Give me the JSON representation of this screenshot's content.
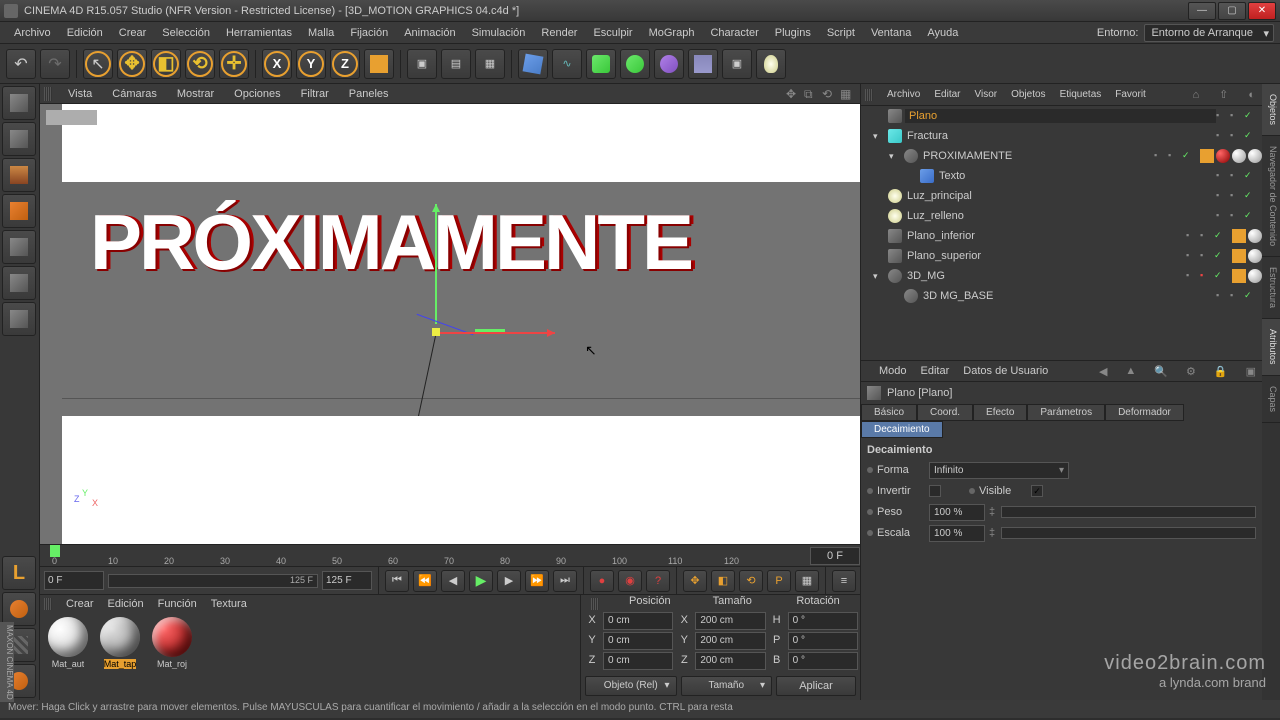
{
  "window": {
    "title": "CINEMA 4D R15.057 Studio (NFR Version - Restricted License) - [3D_MOTION GRAPHICS 04.c4d *]"
  },
  "menubar": {
    "items": [
      "Archivo",
      "Edición",
      "Crear",
      "Selección",
      "Herramientas",
      "Malla",
      "Fijación",
      "Animación",
      "Simulación",
      "Render",
      "Esculpir",
      "MoGraph",
      "Character",
      "Plugins",
      "Script",
      "Ventana",
      "Ayuda"
    ],
    "env_label": "Entorno:",
    "env_value": "Entorno de Arranque"
  },
  "viewmenu": {
    "items": [
      "Vista",
      "Cámaras",
      "Mostrar",
      "Opciones",
      "Filtrar",
      "Paneles"
    ]
  },
  "viewport": {
    "text3d": "PRÓXIMAMENTE",
    "axes": {
      "x": "X",
      "y": "Y",
      "z": "Z"
    }
  },
  "timeline": {
    "ticks": [
      "0",
      "10",
      "20",
      "30",
      "40",
      "50",
      "60",
      "70",
      "80",
      "90",
      "100",
      "110",
      "120"
    ],
    "range_end": "0 F"
  },
  "transport": {
    "cur_frame": "0 F",
    "range": "125 F",
    "total": "125 F"
  },
  "materials": {
    "menu": [
      "Crear",
      "Edición",
      "Función",
      "Textura"
    ],
    "items": [
      {
        "label": "Mat_aut",
        "color": "white"
      },
      {
        "label": "Mat_tap",
        "color": "grey",
        "selected": true
      },
      {
        "label": "Mat_roj",
        "color": "red"
      }
    ]
  },
  "coord": {
    "headers": [
      "Posición",
      "Tamaño",
      "Rotación"
    ],
    "rows": [
      {
        "axis": "X",
        "pos": "0 cm",
        "sizeAxis": "X",
        "size": "200 cm",
        "rotAxis": "H",
        "rot": "0 °"
      },
      {
        "axis": "Y",
        "pos": "0 cm",
        "sizeAxis": "Y",
        "size": "200 cm",
        "rotAxis": "P",
        "rot": "0 °"
      },
      {
        "axis": "Z",
        "pos": "0 cm",
        "sizeAxis": "Z",
        "size": "200 cm",
        "rotAxis": "B",
        "rot": "0 °"
      }
    ],
    "mode1": "Objeto (Rel)",
    "mode2": "Tamaño",
    "apply": "Aplicar"
  },
  "objmenu": {
    "items": [
      "Archivo",
      "Editar",
      "Visor",
      "Objetos",
      "Etiquetas",
      "Favorit"
    ]
  },
  "tree": [
    {
      "name": "Plano",
      "icon": "plane",
      "depth": 0,
      "exp": "",
      "sel": true,
      "tags": []
    },
    {
      "name": "Fractura",
      "icon": "fract",
      "depth": 0,
      "exp": "▾",
      "tags": []
    },
    {
      "name": "PROXIMAMENTE",
      "icon": "null",
      "depth": 1,
      "exp": "▾",
      "tags": [
        "tag",
        "red",
        "white",
        "white"
      ]
    },
    {
      "name": "Texto",
      "icon": "text",
      "depth": 2,
      "exp": "",
      "tags": []
    },
    {
      "name": "Luz_principal",
      "icon": "light",
      "depth": 0,
      "exp": "",
      "tags": []
    },
    {
      "name": "Luz_relleno",
      "icon": "light",
      "depth": 0,
      "exp": "",
      "tags": []
    },
    {
      "name": "Plano_inferior",
      "icon": "plane",
      "depth": 0,
      "exp": "",
      "tags": [
        "tag",
        "white"
      ]
    },
    {
      "name": "Plano_superior",
      "icon": "plane",
      "depth": 0,
      "exp": "",
      "tags": [
        "tag",
        "white"
      ]
    },
    {
      "name": "3D_MG",
      "icon": "null",
      "depth": 0,
      "exp": "▾",
      "vis": "red",
      "tags": [
        "tag",
        "white"
      ]
    },
    {
      "name": "3D MG_BASE",
      "icon": "null",
      "depth": 1,
      "exp": "",
      "tags": []
    }
  ],
  "attrmenu": {
    "items": [
      "Modo",
      "Editar",
      "Datos de Usuario"
    ]
  },
  "attr": {
    "title": "Plano [Plano]",
    "tabs": [
      "Básico",
      "Coord.",
      "Efecto",
      "Parámetros",
      "Deformador"
    ],
    "tab_selected": "Decaimiento",
    "section": "Decaimiento",
    "forma_label": "Forma",
    "forma_value": "Infinito",
    "invertir_label": "Invertir",
    "visible_label": "Visible",
    "peso_label": "Peso",
    "peso_value": "100 %",
    "escala_label": "Escala",
    "escala_value": "100 %"
  },
  "rtabs": [
    "Objetos",
    "Navegador de Contenido",
    "Estructura",
    "Atributos",
    "Capas"
  ],
  "status": "Mover: Haga Click y arrastre para mover elementos. Pulse MAYUSCULAS para cuantificar el movimiento / añadir a la selección en el modo punto. CTRL para resta",
  "watermark": {
    "l1": "video2brain.com",
    "l2": "a lynda.com brand"
  },
  "maxon": "MAXON CINEMA 4D"
}
